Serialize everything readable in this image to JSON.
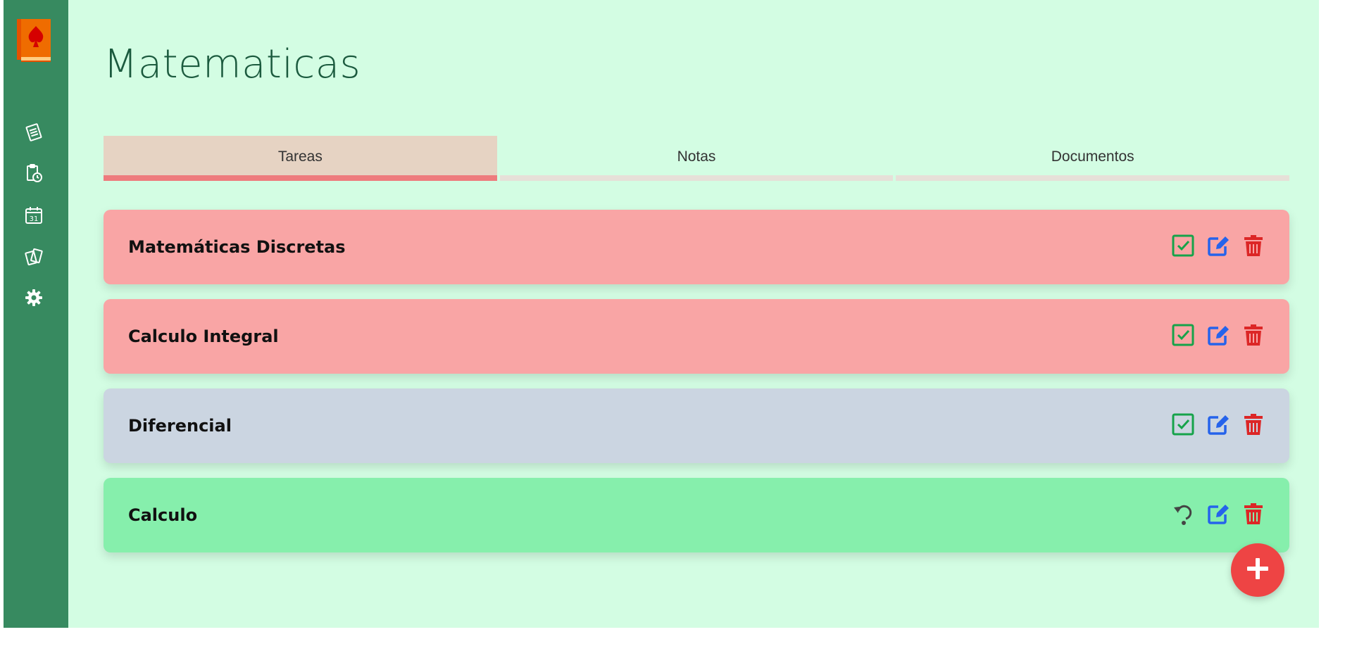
{
  "page": {
    "title": "Matematicas"
  },
  "sidebar": {
    "items": [
      {
        "icon": "notepad-icon",
        "label": "Apuntes"
      },
      {
        "icon": "clipboard-clock-icon",
        "label": "Pendientes"
      },
      {
        "icon": "calendar-icon",
        "label": "Calendario",
        "day": "31"
      },
      {
        "icon": "cards-icon",
        "label": "Tarjetas"
      },
      {
        "icon": "gear-icon",
        "label": "Ajustes"
      }
    ]
  },
  "tabs": [
    {
      "label": "Tareas",
      "active": true
    },
    {
      "label": "Notas",
      "active": false
    },
    {
      "label": "Documentos",
      "active": false
    }
  ],
  "tasks": [
    {
      "title": "Matemáticas Discretas",
      "color": "#f9a5a5",
      "done": false
    },
    {
      "title": "Calculo Integral",
      "color": "#f9a5a5",
      "done": false
    },
    {
      "title": "Diferencial",
      "color": "#cbd5e1",
      "done": false
    },
    {
      "title": "Calculo",
      "color": "#86efac",
      "done": true
    }
  ],
  "colors": {
    "sidebar": "#378a60",
    "background": "#d3fde3",
    "accent": "#ee4444",
    "complete": "#16a34a",
    "edit": "#2563eb",
    "delete": "#dc2626"
  }
}
